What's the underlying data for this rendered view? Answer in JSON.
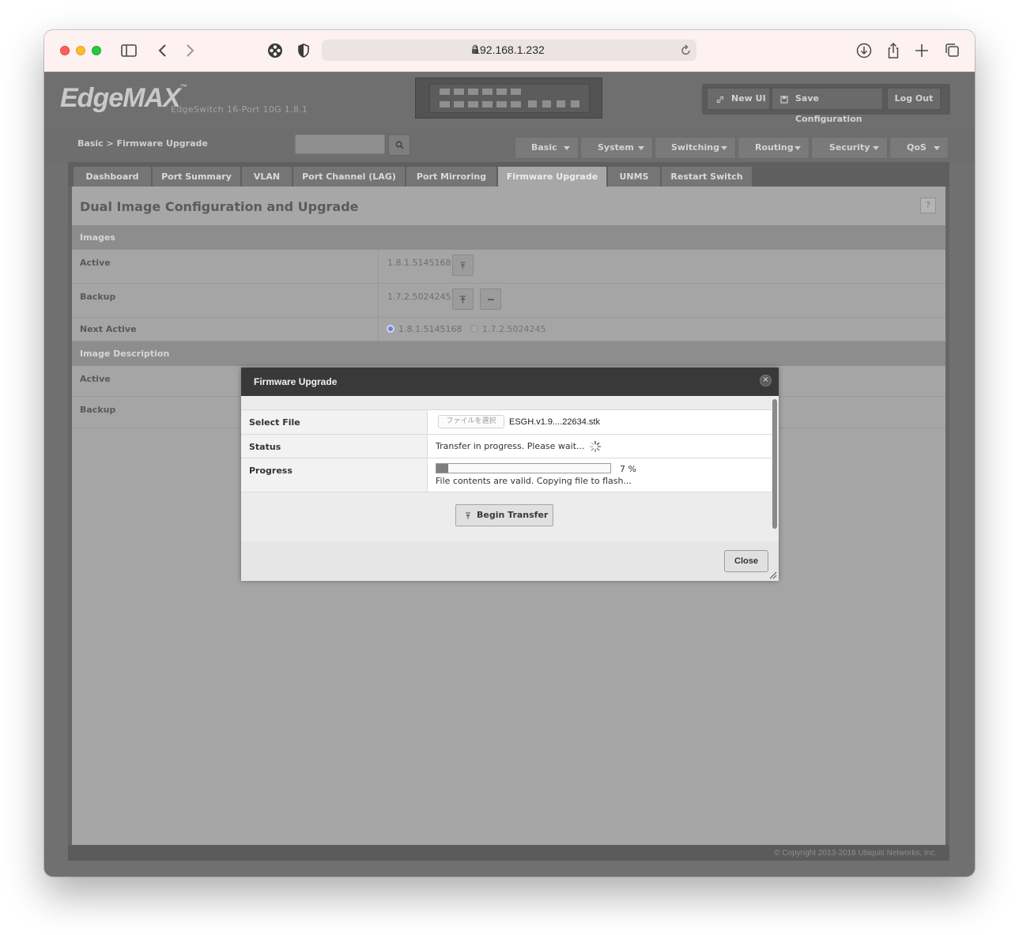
{
  "browser": {
    "url": "192.168.1.232",
    "icons": [
      "sidebar-icon",
      "back-icon",
      "forward-icon",
      "extension-icon",
      "privacy-shield-icon",
      "lock-icon",
      "reload-icon",
      "download-icon",
      "share-icon",
      "new-tab-icon",
      "tabs-overview-icon"
    ]
  },
  "header": {
    "logo_text": "EdgeMAX",
    "logo_tm": "™",
    "device_name": "EdgeSwitch 16-Port 10G 1.8.1",
    "buttons": {
      "new_ui": "New UI",
      "save_config": "Save Configuration",
      "logout": "Log Out"
    }
  },
  "nav": {
    "breadcrumb": "Basic > Firmware Upgrade",
    "search_placeholder": "",
    "menus": [
      "Basic",
      "System",
      "Switching",
      "Routing",
      "Security",
      "QoS"
    ]
  },
  "tabs": [
    "Dashboard",
    "Port Summary",
    "VLAN",
    "Port Channel (LAG)",
    "Port Mirroring",
    "Firmware Upgrade",
    "UNMS",
    "Restart Switch"
  ],
  "active_tab": "Firmware Upgrade",
  "content": {
    "title": "Dual Image Configuration and Upgrade",
    "help": "?",
    "images_section": "Images",
    "active_label": "Active",
    "active_version": "1.8.1.5145168",
    "backup_label": "Backup",
    "backup_version": "1.7.2.5024245",
    "next_active_label": "Next Active",
    "next_active_options": [
      "1.8.1.5145168",
      "1.7.2.5024245"
    ],
    "next_active_selected": "1.8.1.5145168",
    "description_section": "Image Description",
    "desc_active_label": "Active",
    "desc_backup_label": "Backup"
  },
  "dialog": {
    "title": "Firmware Upgrade",
    "select_file_label": "Select File",
    "file_button": "ファイルを選択",
    "file_name": "ESGH.v1.9....22634.stk",
    "status_label": "Status",
    "status_text": "Transfer in progress. Please wait...",
    "progress_label": "Progress",
    "progress_percent": 7,
    "progress_text": "7 %",
    "progress_message": "File contents are valid. Copying file to flash...",
    "begin_button": "Begin Transfer",
    "close_button": "Close"
  },
  "footer": {
    "copyright": "© Copyright 2013-2018 Ubiquiti Networks, Inc."
  },
  "colors": {
    "overlay_gray": "#a5a5a5",
    "dialog_header": "#393939",
    "traffic_red": "#fe5f57",
    "traffic_yellow": "#febc2e",
    "traffic_green": "#28c840",
    "radio_selected": "#6d83c9"
  }
}
